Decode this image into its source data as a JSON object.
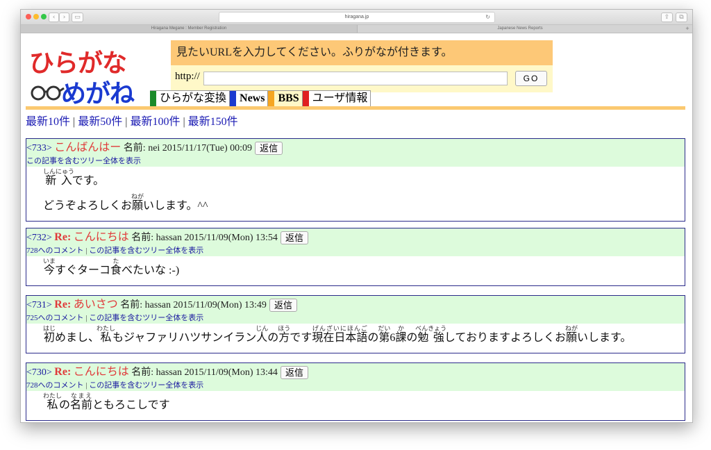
{
  "browser": {
    "address": "hiragana.jp",
    "tabs": [
      {
        "label": "Hiragana Megane : Member Registration"
      },
      {
        "label": "Japanese News Reports"
      }
    ],
    "tab_add": "+"
  },
  "logo": {
    "line1": "ひらがな",
    "line2": "めがね"
  },
  "url_tool": {
    "heading": "見たいURLを入力してください。ふりがなが付きます。",
    "prefix": "http://",
    "input_value": "",
    "go_label": "GO"
  },
  "menu": [
    {
      "label": "ひらがな変換",
      "color": "#1a8a2a"
    },
    {
      "label": "News",
      "color": "#1a3ad0"
    },
    {
      "label": "BBS",
      "color": "#f5a623"
    },
    {
      "label": "ユーザ情報",
      "color": "#e02020"
    }
  ],
  "latest_links": [
    "最新10件",
    "最新50件",
    "最新100件",
    "最新150件"
  ],
  "latest_sep": "|",
  "posts": [
    {
      "num": "<733>",
      "re": "",
      "title": "こんばんはー",
      "meta": "名前: nei 2015/11/17(Tue) 00:09",
      "reply": "返信",
      "link1": "",
      "link2": "この記事を含むツリー全体を表示",
      "body": [
        [
          [
            "新入",
            "しんにゅう"
          ],
          [
            "です。",
            ""
          ]
        ],
        [
          [
            "どうぞよろしくお",
            ""
          ],
          [
            "願",
            "ねが"
          ],
          [
            "いします。^^",
            ""
          ]
        ]
      ]
    },
    {
      "num": "<732>",
      "re": "Re:",
      "title": "こんにちは",
      "meta": "名前: hassan 2015/11/09(Mon) 13:54",
      "reply": "返信",
      "link1": "728へのコメント",
      "link2": "この記事を含むツリー全体を表示",
      "body": [
        [
          [
            "今",
            "いま"
          ],
          [
            "すぐターコ",
            ""
          ],
          [
            "食",
            "た"
          ],
          [
            "べたいな :-)",
            ""
          ]
        ]
      ]
    },
    {
      "num": "<731>",
      "re": "Re:",
      "title": "あいさつ",
      "meta": "名前: hassan 2015/11/09(Mon) 13:49",
      "reply": "返信",
      "link1": "725へのコメント",
      "link2": "この記事を含むツリー全体を表示",
      "body": [
        [
          [
            "初",
            "はじ"
          ],
          [
            "めまし、",
            ""
          ],
          [
            "私",
            "わたし"
          ],
          [
            "もジャファリハツサンイラン",
            ""
          ],
          [
            "人",
            "じん"
          ],
          [
            "の",
            ""
          ],
          [
            "方",
            "ほう"
          ],
          [
            "です",
            ""
          ],
          [
            "現在日本語",
            "げんざいにほんご"
          ],
          [
            "の",
            ""
          ],
          [
            "第",
            "だい"
          ],
          [
            "6",
            ""
          ],
          [
            "課",
            "か"
          ],
          [
            "の",
            ""
          ],
          [
            "勉強",
            "べんきょう"
          ],
          [
            "しておりますよろしくお",
            ""
          ],
          [
            "願",
            "ねが"
          ],
          [
            "いします。",
            ""
          ]
        ]
      ]
    },
    {
      "num": "<730>",
      "re": "Re:",
      "title": "こんにちは",
      "meta": "名前: hassan 2015/11/09(Mon) 13:44",
      "reply": "返信",
      "link1": "728へのコメント",
      "link2": "この記事を含むツリー全体を表示",
      "body": [
        [
          [
            "私",
            "わたし"
          ],
          [
            "の",
            ""
          ],
          [
            "名前",
            "なまえ"
          ],
          [
            "ともろこしです",
            ""
          ]
        ]
      ]
    }
  ],
  "colors": {
    "link": "#1a1aa0",
    "title_red": "#e03a3a",
    "post_head_bg": "#ddfbdc",
    "orange": "#fbc970"
  }
}
